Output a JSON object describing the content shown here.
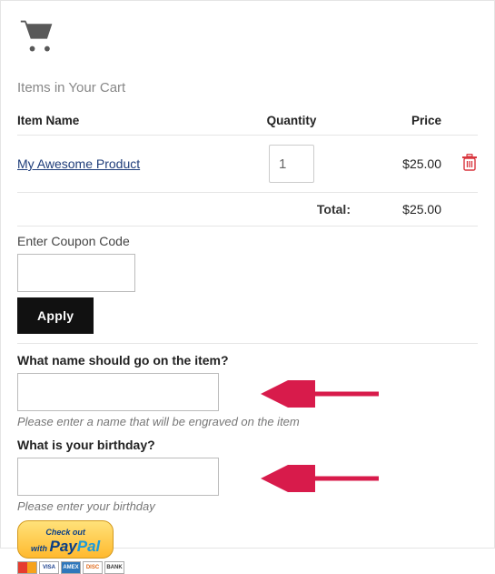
{
  "header": {
    "title": "Items in Your Cart"
  },
  "table": {
    "headers": {
      "name": "Item Name",
      "qty": "Quantity",
      "price": "Price"
    },
    "rows": [
      {
        "name": "My Awesome Product",
        "qty": "1",
        "price": "$25.00"
      }
    ],
    "total_label": "Total:",
    "total_value": "$25.00"
  },
  "coupon": {
    "label": "Enter Coupon Code",
    "value": "",
    "apply": "Apply"
  },
  "questions": [
    {
      "label": "What name should go on the item?",
      "value": "",
      "help": "Please enter a name that will be engraved on the item"
    },
    {
      "label": "What is your birthday?",
      "value": "",
      "help": "Please enter your birthday"
    }
  ],
  "checkout": {
    "line1": "Check out",
    "line1b": "with",
    "brand_a": "Pay",
    "brand_b": "Pal",
    "cards": [
      "MC",
      "VISA",
      "AMEX",
      "DISC",
      "BANK"
    ]
  }
}
